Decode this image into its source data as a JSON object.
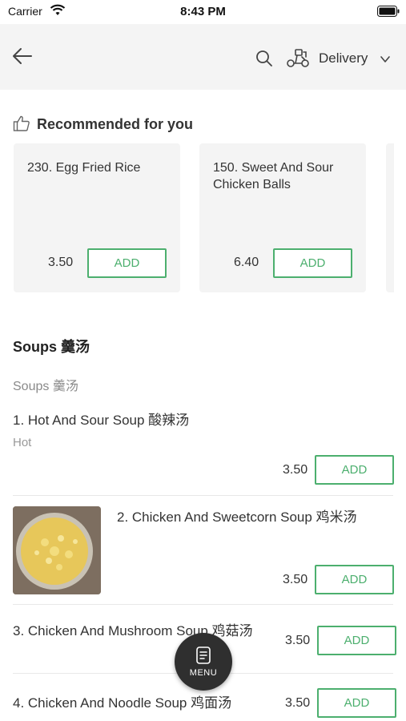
{
  "status_bar": {
    "carrier": "Carrier",
    "time": "8:43 PM"
  },
  "header": {
    "delivery_label": "Delivery"
  },
  "recommended": {
    "title": "Recommended for you",
    "cards": [
      {
        "name": "230. Egg Fried Rice",
        "price": "3.50",
        "add_label": "ADD"
      },
      {
        "name": "150. Sweet And Sour Chicken Balls",
        "price": "6.40",
        "add_label": "ADD"
      }
    ]
  },
  "section": {
    "title": "Soups 羹汤",
    "subtitle": "Soups 羹汤"
  },
  "items": [
    {
      "name": "1. Hot And Sour Soup 酸辣汤",
      "desc": "Hot",
      "price": "3.50",
      "add_label": "ADD"
    },
    {
      "name": "2. Chicken And Sweetcorn Soup 鸡米汤",
      "price": "3.50",
      "add_label": "ADD"
    },
    {
      "name": "3. Chicken And Mushroom Soup 鸡菇汤",
      "price": "3.50",
      "add_label": "ADD"
    },
    {
      "name": "4. Chicken And Noodle Soup 鸡面汤",
      "price": "3.50",
      "add_label": "ADD"
    }
  ],
  "menu_button": {
    "label": "MENU"
  },
  "colors": {
    "accent": "#4caf6e",
    "header_bg": "#f4f4f4",
    "fab_bg": "#2f2f2f"
  },
  "icons": [
    "wifi-icon",
    "battery-icon",
    "back-arrow-icon",
    "search-icon",
    "scooter-icon",
    "chevron-down-icon",
    "thumbs-up-icon",
    "menu-list-icon"
  ]
}
